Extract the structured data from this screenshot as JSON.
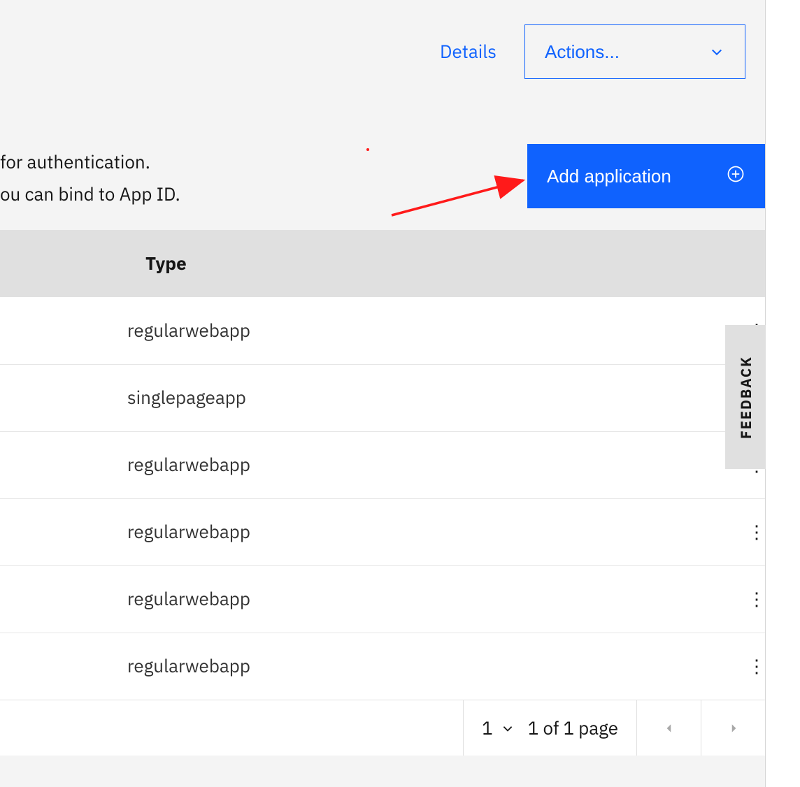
{
  "header": {
    "details_label": "Details",
    "actions_label": "Actions..."
  },
  "description": {
    "line1": "for authentication.",
    "line2": "ou can bind to App ID."
  },
  "add_button": {
    "label": "Add application"
  },
  "table": {
    "columns": {
      "type": "Type"
    },
    "rows": [
      {
        "type": "regularwebapp"
      },
      {
        "type": "singlepageapp"
      },
      {
        "type": "regularwebapp"
      },
      {
        "type": "regularwebapp"
      },
      {
        "type": "regularwebapp"
      },
      {
        "type": "regularwebapp"
      }
    ]
  },
  "pagination": {
    "page_select": "1",
    "status": "1 of 1 page"
  },
  "feedback": {
    "label": "FEEDBACK"
  },
  "colors": {
    "accent": "#0f62fe",
    "background": "#f4f4f4"
  }
}
